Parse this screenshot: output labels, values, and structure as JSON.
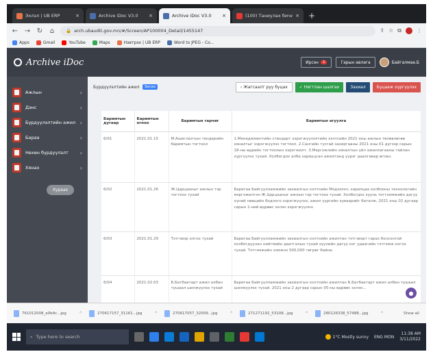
{
  "browser": {
    "tabs": [
      {
        "title": "Эхлэл | UB ERP",
        "fav_color": "#e8734a",
        "active": false
      },
      {
        "title": "Archive iDoc V3.0",
        "fav_color": "#4a6ea8",
        "active": false
      },
      {
        "title": "Archive iDoc V3.0",
        "fav_color": "#4a6ea8",
        "active": true
      },
      {
        "title": "(100) Таниулах бичиг орд | Шинэ...",
        "fav_color": "#e53935",
        "active": false
      }
    ],
    "new_tab": "+",
    "url": "arch.ubaudit.gov.mn/#/Screen/AP100004_Detail/1455147",
    "bookmarks": [
      {
        "label": "Apps",
        "color": "#4285f4"
      },
      {
        "label": "Gmail",
        "color": "#ea4335"
      },
      {
        "label": "YouTube",
        "color": "#ff0000"
      },
      {
        "label": "Maps",
        "color": "#34a853"
      },
      {
        "label": "Нэвтрэх | UB ERP",
        "color": "#e8734a"
      },
      {
        "label": "Word to JPEG - Co...",
        "color": "#4a6ea8"
      }
    ]
  },
  "app": {
    "logo": "Archive iDoc",
    "header_btn_1": "Ирсэн",
    "header_badge": "1",
    "header_btn_2": "Гарын авлага",
    "user_name": "Байгалмаа.Б"
  },
  "sidebar": {
    "items": [
      {
        "label": "Ажлын"
      },
      {
        "label": "Дэнс"
      },
      {
        "label": "Бүрдүүлэлтийн ажил"
      },
      {
        "label": "Бараа"
      },
      {
        "label": "Нөхөн бүрдүүлэлт"
      },
      {
        "label": "Хянах"
      }
    ],
    "exit_label": "Хураах"
  },
  "main": {
    "breadcrumb": "Бүрдүүлэлтийн ажил",
    "breadcrumb_tag": "Засах",
    "back_label": "Жагсаалт руу буцах",
    "approve_label": "Нягтлан шалгах",
    "order_label": "Захиал",
    "reject_label": "Буцааж хүргүүлэх",
    "columns": [
      "Баримтын дугаар",
      "Баримтын огноо",
      "Баримтын гарчиг",
      "Баримтын агуулга"
    ],
    "rows": [
      {
        "no": "6/01",
        "date": "2021.01.15",
        "title": "М.Ашиглалтын тендерийн баримтын тогтоол",
        "body": "1.Менеджментийн стандарт хэрэгжүүлэлтийн хэлтсийн 2021 оны ажлын төлөвлөгөө хяналтыг хэрэгжүүлэх тогтоол. 2.Сангийн тусгай захиргааны 2021 оны 01 дүгээр сарын 18-ны өдрийн тогтоолын хэрэгжилт. 3.Мэргэжлийн хяналтын үйл ажиллагааны тайлан хүргүүлэх тухай. Холбогдох алба хариуцсан ажилтанд үүрэг даалгавар өгсөн."
      },
      {
        "no": "6/02",
        "date": "2021.01.26",
        "title": "Ж.Царцааныг ажлын тэр тогтоох тухай",
        "body": "Баригаа Байгуулламжийн захиалгын хэлтсийн Мэдээлэл, харилцаа холбооны технологийн мэргэжилтэн Ж.Царцааныг ажлын тэр тогтоох тухай. Холбогдох хууль тогтоомжийн дагуу хүний нөөцийн бодлого хэрэгжүүлэх, ажил үүргийн хуваарийг баталж, 2021 оны 02 дугаар сарын 1-ний өдрөөс эхлэн хэрэгжүүлнэ."
      },
      {
        "no": "6/03",
        "date": "2021.01.29",
        "title": "Тэтгэвэр олгох тухай",
        "body": "Баригаа Байгуулламжийн захиалгын хэлтсийн ажилтан тэтгэвэрт гарах болсонтой холбогдуулан нийгмийн даатгалын тухай хуулийн дагуу нэг удаагийн тэтгэмж олгох тухай. Тэтгэмжийн хэмжээ 500,000 төгрөг байна."
      },
      {
        "no": "6/04",
        "date": "2021.02.03",
        "title": "Б.Батбаатарт ажил албан тушаал шилжүүлэх тухай",
        "body": "Баригаа Байгуулламжийн захиалгын хэлтсийн ажилтан Б.Батбаатарт ажил албан тушаал шилжүүлэх тухай. 2021 оны 2 дугаар сарын 05-ны өдрөөс эхлэн..."
      }
    ]
  },
  "downloads": [
    {
      "name": "761012008_a0b4c...jpg"
    },
    {
      "name": "270617157_31161...jpg"
    },
    {
      "name": "270617057_32009...jpg"
    },
    {
      "name": "271271192_53108...jpg"
    },
    {
      "name": "280126338_57488...jpg"
    }
  ],
  "show_all": "Show all",
  "taskbar": {
    "search_placeholder": "Type here to search",
    "app_colors": [
      "#666",
      "#2f80ed",
      "#0a7cd8",
      "#1565c0",
      "#e0a400",
      "#5f6368",
      "#2e7d32",
      "#e53935",
      "#0078d4"
    ],
    "weather": "1°C  Mostly sunny",
    "lang": "ENG MON",
    "time": "11:38 AM",
    "date": "3/11/2022"
  }
}
